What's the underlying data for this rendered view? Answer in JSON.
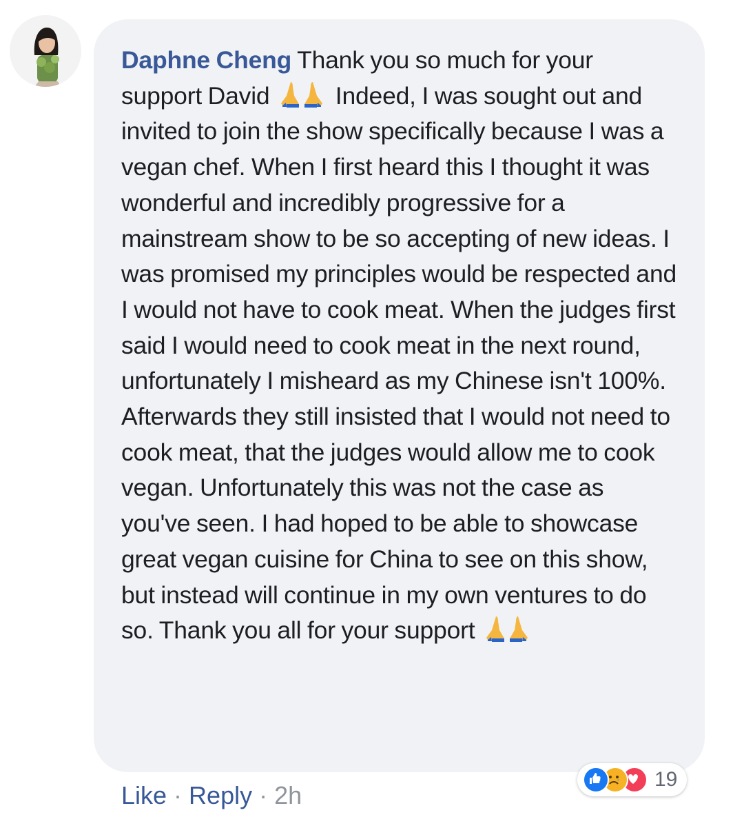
{
  "comment": {
    "author": "Daphne Cheng",
    "body_segments": [
      "Thank you so much for your support David",
      "Indeed, I was sought out and invited to join the show specifically because I was a vegan chef. When I first heard this I thought it was wonderful and incredibly progressive for a mainstream show to be so accepting of new ideas. I was promised my principles would be respected and I would not have to cook meat. When the judges first said I would need to cook meat in the next round, unfortunately I misheard as my Chinese isn't 100%. Afterwards they still insisted that I would not need to cook meat, that the judges would allow me to cook vegan. Unfortunately this was not the case as you've seen. I had hoped to be able to showcase great vegan cuisine for China to see on this show, but instead will continue in my own ventures to do so. Thank you all for your support"
    ],
    "emojis": [
      "folded-hands-icon",
      "folded-hands-icon"
    ],
    "reactions": {
      "icons": [
        "like-icon",
        "sad-icon",
        "love-icon"
      ],
      "count": "19"
    },
    "actions": {
      "like": "Like",
      "reply": "Reply",
      "separator": "·",
      "time": "2h"
    }
  },
  "colors": {
    "author": "#385898",
    "bubble": "#f0f2f5",
    "text": "#1c1e21",
    "meta": "#90949c",
    "like": "#1877f2",
    "sad": "#f7b125",
    "love": "#f33e58"
  }
}
